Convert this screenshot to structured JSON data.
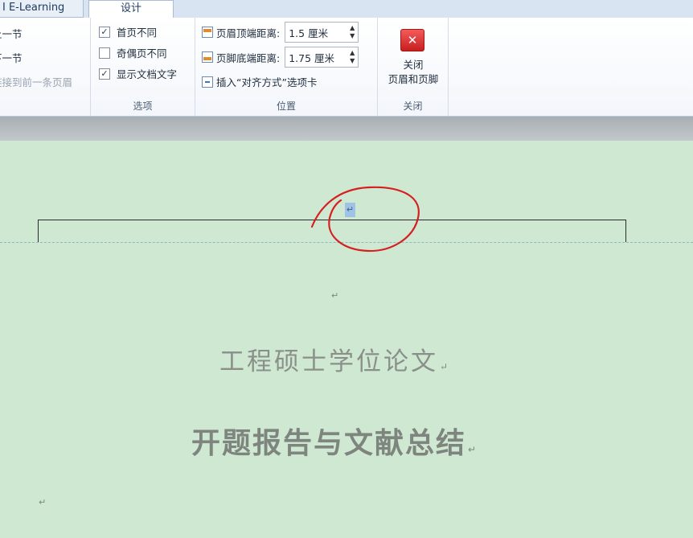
{
  "tabs": [
    {
      "label": "I E-Learning"
    },
    {
      "label": "设计"
    }
  ],
  "navigation": {
    "items": [
      {
        "label": "上一节"
      },
      {
        "label": "下一节"
      },
      {
        "label": "链接到前一条页眉"
      }
    ]
  },
  "options": {
    "label": "选项",
    "items": [
      {
        "label": "首页不同",
        "checked": true
      },
      {
        "label": "奇偶页不同",
        "checked": false
      },
      {
        "label": "显示文档文字",
        "checked": true
      }
    ]
  },
  "position": {
    "label": "位置",
    "header_label": "页眉顶端距离:",
    "header_value": "1.5 厘米",
    "footer_label": "页脚底端距离:",
    "footer_value": "1.75 厘米",
    "insert_label": "插入“对齐方式”选项卡"
  },
  "close": {
    "label": "关闭",
    "button_line1": "关闭",
    "button_line2": "页眉和页脚",
    "icon_glyph": "✕"
  },
  "document": {
    "paragraph_mark": "↵",
    "title1": "工程硕士学位论文",
    "title2": "开题报告与文献总结"
  },
  "colors": {
    "page_background": "#cfe8d2",
    "annotation": "#d42020",
    "selection": "#9fc3e7"
  }
}
